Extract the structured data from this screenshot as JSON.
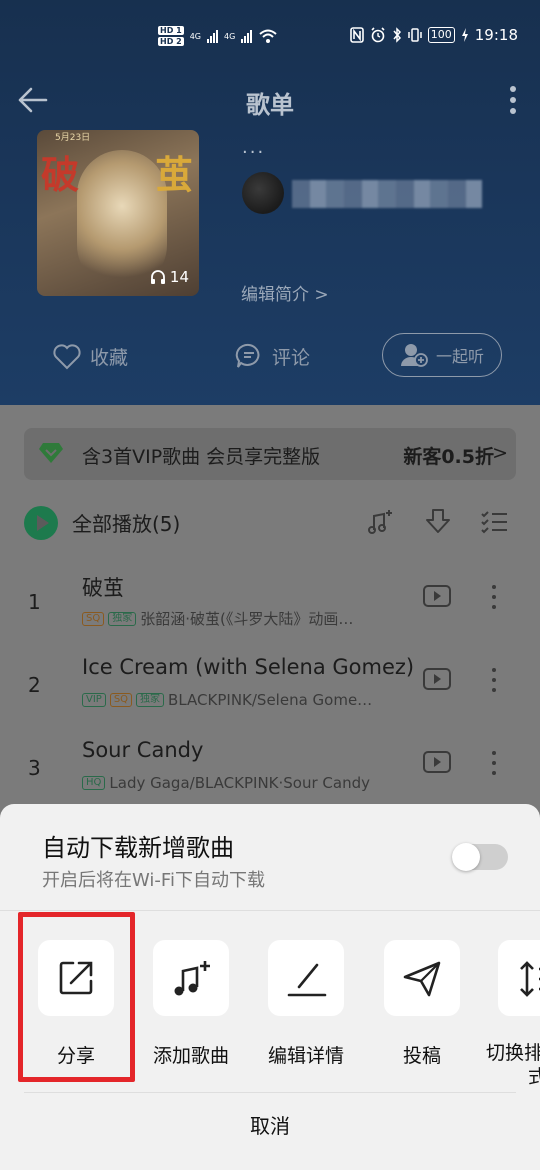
{
  "status_bar": {
    "hd_badges": [
      "HD 1",
      "HD 2"
    ],
    "net_labels": [
      "4G",
      "4G"
    ],
    "battery": "100",
    "time": "19:18"
  },
  "header": {
    "title": "歌单",
    "playlist_name": "···",
    "edit_intro": "编辑简介 >",
    "cover": {
      "title_left": "破",
      "title_right": "茧",
      "date": "5月23日",
      "play_count": "14"
    }
  },
  "actions": {
    "favorite": "收藏",
    "comment": "评论",
    "listen_together": "一起听"
  },
  "vip_bar": {
    "text": "含3首VIP歌曲 会员享完整版",
    "promo": "新客0.5折",
    "chevron": ">"
  },
  "play_all": {
    "label": "全部播放(5)"
  },
  "songs": [
    {
      "num": "1",
      "title": "破茧",
      "tags": [
        "SQ",
        "独家"
      ],
      "meta": "张韶涵·破茧(《斗罗大陆》动画…"
    },
    {
      "num": "2",
      "title": "Ice Cream (with Selena Gomez)",
      "tags": [
        "VIP",
        "SQ",
        "独家"
      ],
      "meta": "BLACKPINK/Selena Gome…"
    },
    {
      "num": "3",
      "title": "Sour Candy",
      "tags": [
        "HQ"
      ],
      "meta": "Lady Gaga/BLACKPINK·Sour Candy"
    }
  ],
  "sheet": {
    "auto_download_title": "自动下载新增歌曲",
    "auto_download_subtitle": "开启后将在Wi-Fi下自动下载",
    "auto_download_enabled": false,
    "options": [
      {
        "label": "分享",
        "icon": "share-icon"
      },
      {
        "label": "添加歌曲",
        "icon": "add-song-icon"
      },
      {
        "label": "编辑详情",
        "icon": "edit-icon"
      },
      {
        "label": "投稿",
        "icon": "paper-plane-icon"
      },
      {
        "label": "切换排",
        "label2": "式",
        "icon": "sort-icon"
      }
    ],
    "cancel": "取消"
  },
  "colors": {
    "header_bg": "#1a365a",
    "overlay": "#7b7b7b",
    "sheet_bg": "#f1f1f1",
    "highlight": "#e4262a",
    "play_green": "#1d7a4d"
  }
}
